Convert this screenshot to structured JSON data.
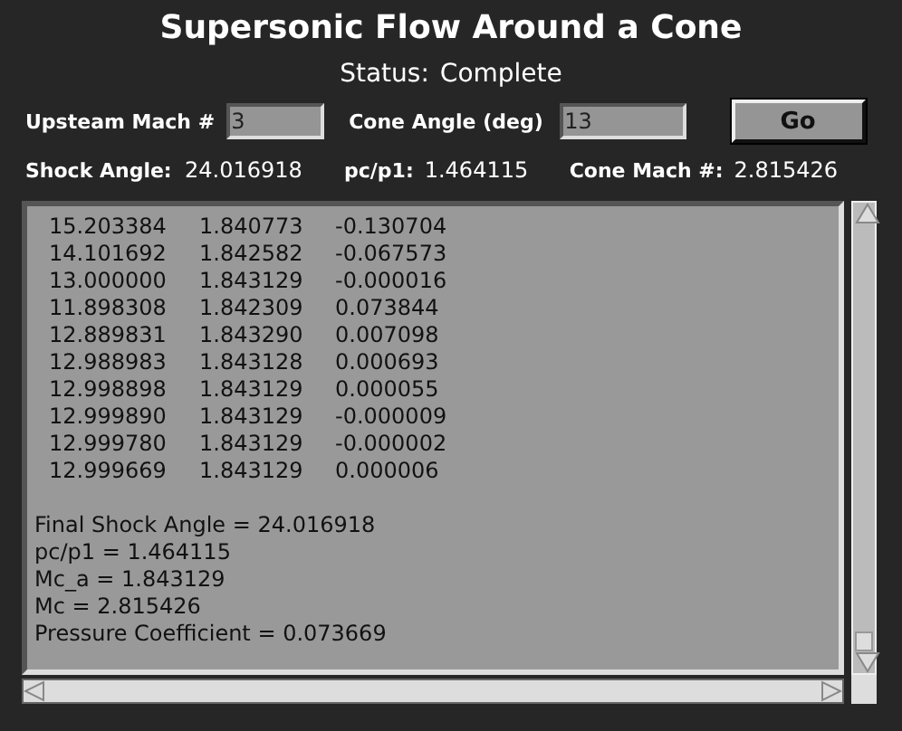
{
  "title": "Supersonic Flow Around a Cone",
  "status": {
    "label": "Status:",
    "value": "Complete"
  },
  "inputs": [
    {
      "label": "Upsteam Mach #",
      "value": "3"
    },
    {
      "label": "Cone Angle (deg)",
      "value": "13"
    }
  ],
  "button": "Go",
  "results": [
    {
      "label": "Shock Angle:",
      "value": "24.016918"
    },
    {
      "label": "pc/p1:",
      "value": "1.464115"
    },
    {
      "label": "Cone Mach #:",
      "value": "2.815426"
    }
  ],
  "output": {
    "rows": [
      [
        "15.203384",
        "1.840773",
        "-0.130704"
      ],
      [
        "14.101692",
        "1.842582",
        "-0.067573"
      ],
      [
        "13.000000",
        "1.843129",
        "-0.000016"
      ],
      [
        "11.898308",
        "1.842309",
        "0.073844"
      ],
      [
        "12.889831",
        "1.843290",
        "0.007098"
      ],
      [
        "12.988983",
        "1.843128",
        "0.000693"
      ],
      [
        "12.998898",
        "1.843129",
        "0.000055"
      ],
      [
        "12.999890",
        "1.843129",
        "-0.000009"
      ],
      [
        "12.999780",
        "1.843129",
        "-0.000002"
      ],
      [
        "12.999669",
        "1.843129",
        "0.000006"
      ]
    ],
    "summary": [
      "Final Shock Angle = 24.016918",
      "pc/p1 = 1.464115",
      "Mc_a = 1.843129",
      "Mc = 2.815426",
      "Pressure Coefficient = 0.073669"
    ]
  }
}
